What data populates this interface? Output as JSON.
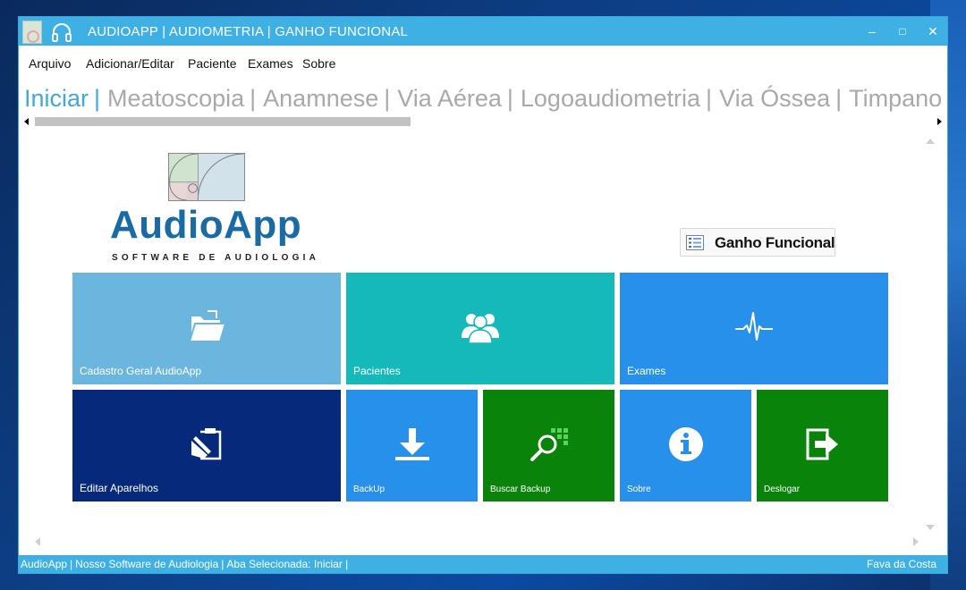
{
  "window": {
    "title": "AUDIOAPP | AUDIOMETRIA | GANHO FUNCIONAL",
    "minimize": "–",
    "maximize": "□",
    "close": "✕"
  },
  "menu": {
    "items": [
      {
        "label": "Arquivo"
      },
      {
        "label": "Adicionar/Editar"
      },
      {
        "label": "Paciente"
      },
      {
        "label": "Exames"
      },
      {
        "label": "Sobre"
      }
    ]
  },
  "tabs": [
    {
      "label": "Iniciar",
      "active": true
    },
    {
      "label": "Meatoscopia",
      "active": false
    },
    {
      "label": "Anamnese",
      "active": false
    },
    {
      "label": "Via Aérea",
      "active": false
    },
    {
      "label": "Logoaudiometria",
      "active": false
    },
    {
      "label": "Via Óssea",
      "active": false
    },
    {
      "label": "Timpanom",
      "active": false
    }
  ],
  "tab_separator": "|",
  "logo": {
    "wordmark": "AudioApp",
    "tagline": "SOFTWARE DE AUDIOLOGIA"
  },
  "ganho_button": {
    "label": "Ganho Funcional"
  },
  "tiles": [
    {
      "label": "Cadastro Geral AudioApp",
      "color": "#6bb6de",
      "icon": "folder-open-icon"
    },
    {
      "label": "Pacientes",
      "color": "#16b9b9",
      "icon": "users-group-icon"
    },
    {
      "label": "Exames",
      "color": "#2790ea",
      "icon": "heartbeat-icon"
    },
    {
      "label": "Editar Aparelhos",
      "color": "#06297b",
      "icon": "clipboard-edit-icon"
    },
    {
      "label": "BackUp",
      "color": "#2790ea",
      "icon": "download-icon"
    },
    {
      "label": "Buscar Backup",
      "color": "#0a830a",
      "icon": "search-grid-icon"
    },
    {
      "label": "Sobre",
      "color": "#2790ea",
      "icon": "info-icon"
    },
    {
      "label": "Deslogar",
      "color": "#0a830a",
      "icon": "exit-icon"
    }
  ],
  "status": {
    "app": "AudioApp",
    "slogan": "Nosso Software de Audiologia",
    "tab_prefix": "Aba Selecionada:",
    "tab_value": "Iniciar |",
    "user": "Fava da Costa",
    "divider": "|"
  },
  "colors": {
    "titlebar": "#3fb0e3",
    "tab_active": "#3ea9e0",
    "tab_inactive": "#a9a9a9",
    "logo_blue": "#1a6aa3"
  }
}
